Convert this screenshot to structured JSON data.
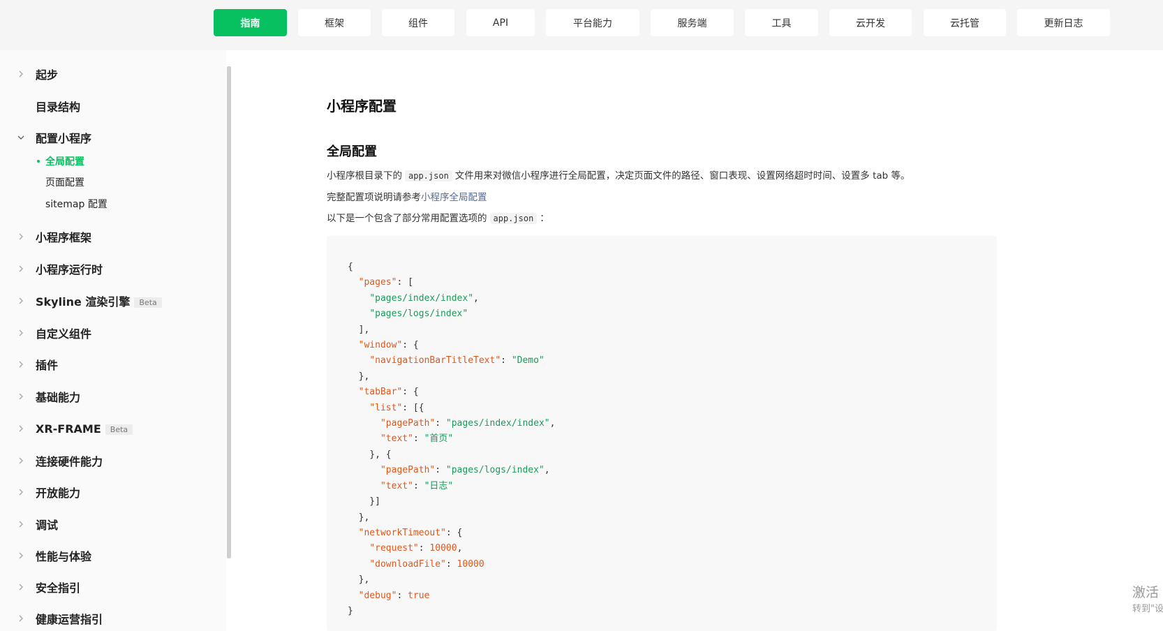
{
  "top_nav": {
    "tabs": [
      {
        "label": "指南",
        "active": true
      },
      {
        "label": "框架"
      },
      {
        "label": "组件"
      },
      {
        "label": "API"
      },
      {
        "label": "平台能力"
      },
      {
        "label": "服务端"
      },
      {
        "label": "工具"
      },
      {
        "label": "云开发"
      },
      {
        "label": "云托管"
      },
      {
        "label": "更新日志"
      }
    ]
  },
  "sidebar": {
    "items": [
      {
        "label": "起步",
        "expandable": true
      },
      {
        "label": "目录结构",
        "expandable": false
      },
      {
        "label": "配置小程序",
        "expandable": true,
        "expanded": true
      },
      {
        "label": "小程序框架",
        "expandable": true
      },
      {
        "label": "小程序运行时",
        "expandable": true
      },
      {
        "label": "Skyline 渲染引擎",
        "expandable": true,
        "badge": "Beta"
      },
      {
        "label": "自定义组件",
        "expandable": true
      },
      {
        "label": "插件",
        "expandable": true
      },
      {
        "label": "基础能力",
        "expandable": true
      },
      {
        "label": "XR-FRAME",
        "expandable": true,
        "badge": "Beta"
      },
      {
        "label": "连接硬件能力",
        "expandable": true
      },
      {
        "label": "开放能力",
        "expandable": true
      },
      {
        "label": "调试",
        "expandable": true
      },
      {
        "label": "性能与体验",
        "expandable": true
      },
      {
        "label": "安全指引",
        "expandable": true
      },
      {
        "label": "健康运营指引",
        "expandable": true
      }
    ],
    "sub_items": [
      {
        "label": "全局配置",
        "active": true
      },
      {
        "label": "页面配置"
      },
      {
        "label": "sitemap 配置"
      }
    ]
  },
  "content": {
    "title": "小程序配置",
    "section_title": "全局配置",
    "para1_before": "小程序根目录下的",
    "para1_code": "app.json",
    "para1_after": "文件用来对微信小程序进行全局配置，决定页面文件的路径、窗口表现、设置网络超时时间、设置多 tab 等。",
    "para2_before": "完整配置项说明请参考",
    "para2_link": "小程序全局配置",
    "para3_before": "以下是一个包含了部分常用配置选项的",
    "para3_code": "app.json",
    "para3_after": "："
  },
  "code": {
    "pages_key": "\"pages\"",
    "page1": "\"pages/index/index\"",
    "page2": "\"pages/logs/index\"",
    "window_key": "\"window\"",
    "nav_title_key": "\"navigationBarTitleText\"",
    "nav_title_val": "\"Demo\"",
    "tabbar_key": "\"tabBar\"",
    "list_key": "\"list\"",
    "pagepath_key": "\"pagePath\"",
    "text_key": "\"text\"",
    "tab1_path": "\"pages/index/index\"",
    "tab1_text": "\"首页\"",
    "tab2_path": "\"pages/logs/index\"",
    "tab2_text": "\"日志\"",
    "timeout_key": "\"networkTimeout\"",
    "request_key": "\"request\"",
    "request_val": "10000",
    "download_key": "\"downloadFile\"",
    "download_val": "10000",
    "debug_key": "\"debug\"",
    "debug_val": "true"
  },
  "watermark": {
    "line1": "激活",
    "line2": "转到\"设"
  },
  "colors": {
    "accent": "#07c160",
    "link": "#576b95",
    "code_key": "#e0571a",
    "code_string": "#1a9a5a"
  }
}
